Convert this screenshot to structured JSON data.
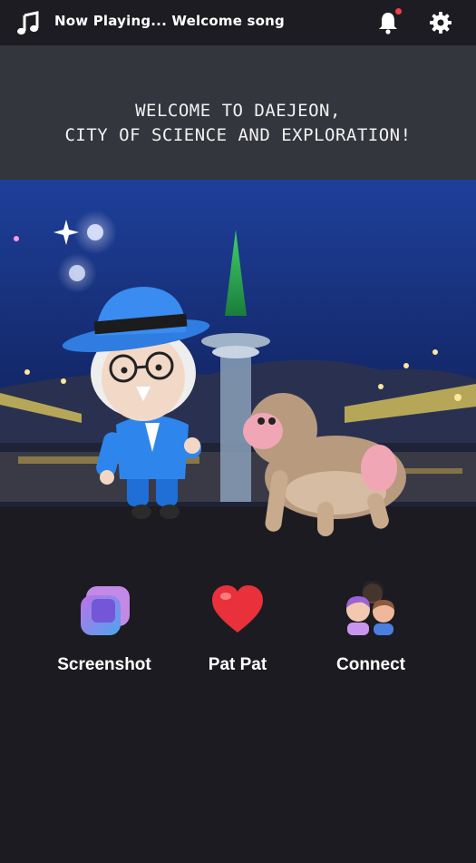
{
  "topbar": {
    "now_playing": "Now Playing... Welcome song",
    "icons": [
      "music-note-icon",
      "bell-icon",
      "gear-icon"
    ],
    "notification_dot": true
  },
  "banner": {
    "line1": "WELCOME TO DAEJEON,",
    "line2": "CITY OF SCIENCE AND EXPLORATION!"
  },
  "actions": [
    {
      "label": "Screenshot",
      "icon": "screenshot-icon"
    },
    {
      "label": "Pat Pat",
      "icon": "heart-icon"
    },
    {
      "label": "Connect",
      "icon": "people-icon"
    }
  ],
  "colors": {
    "background": "#1c1b21",
    "banner": "#34363d",
    "accent_red": "#ef3e4a",
    "heart": "#e8313a",
    "sky": "#152c72"
  }
}
